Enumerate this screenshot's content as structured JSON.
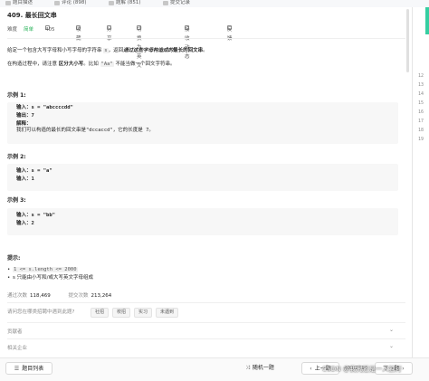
{
  "tabs": [
    {
      "label": "题目描述",
      "active": true
    },
    {
      "label": "评论 (898)"
    },
    {
      "label": "题解 (851)"
    },
    {
      "label": "提交记录"
    }
  ],
  "problem": {
    "title": "409. 最长回文串",
    "difficulty_label": "难度",
    "difficulty": "简单",
    "likes": "405",
    "favorite": "收藏",
    "share": "分享",
    "switch_lang": "切换为英文",
    "notify": "接收动态",
    "feedback": "反馈",
    "desc1_a": "给定一个包含大写字母和小写字母的字符串",
    "desc1_code": "s",
    "desc1_b": "，返回",
    "desc1_em": "通过这些字母构造成的",
    "desc1_bold": "最长的回文串",
    "desc1_c": "。",
    "desc2_a": "在构造过程中，请注意",
    "desc2_bold": "区分大小写",
    "desc2_b": "。比如",
    "desc2_code": "\"Aa\"",
    "desc2_c": "不能当做一个回文字符串。"
  },
  "examples": [
    {
      "heading": "示例 1:",
      "input": "输入：s = \"abccccdd\"",
      "output": "输出：7",
      "explain_label": "解释：",
      "explain": "我们可以构造的最长的回文串是\"dccaccd\"，它的长度是 7。"
    },
    {
      "heading": "示例 2:",
      "input": "输入：s = \"a\"",
      "output": "输入：1"
    },
    {
      "heading": "示例 3:",
      "input": "输入：s = \"bb\"",
      "output": "输入：2"
    }
  ],
  "hints": {
    "heading": "提示:",
    "items": [
      "1 <= s.length <= 2000",
      "s 只能由小写和/或大写英文字母组成"
    ]
  },
  "stats": {
    "passed_label": "通过次数",
    "passed": "118,469",
    "submitted_label": "提交次数",
    "submitted": "213,264"
  },
  "interview": {
    "question": "请问您在哪类招聘中遇到此题?",
    "chips": [
      "社招",
      "校招",
      "实习",
      "未遇到"
    ]
  },
  "sections": [
    "贡献者",
    "相关企业"
  ],
  "gutter_lines": [
    "12",
    "13",
    "14",
    "15",
    "16",
    "17",
    "18",
    "19"
  ],
  "bottom": {
    "list": "题目列表",
    "random": "随机一题",
    "prev": "上一题",
    "page": "409/2593",
    "next": "下一题"
  },
  "watermark": "CSDN @我究还是一人独行"
}
